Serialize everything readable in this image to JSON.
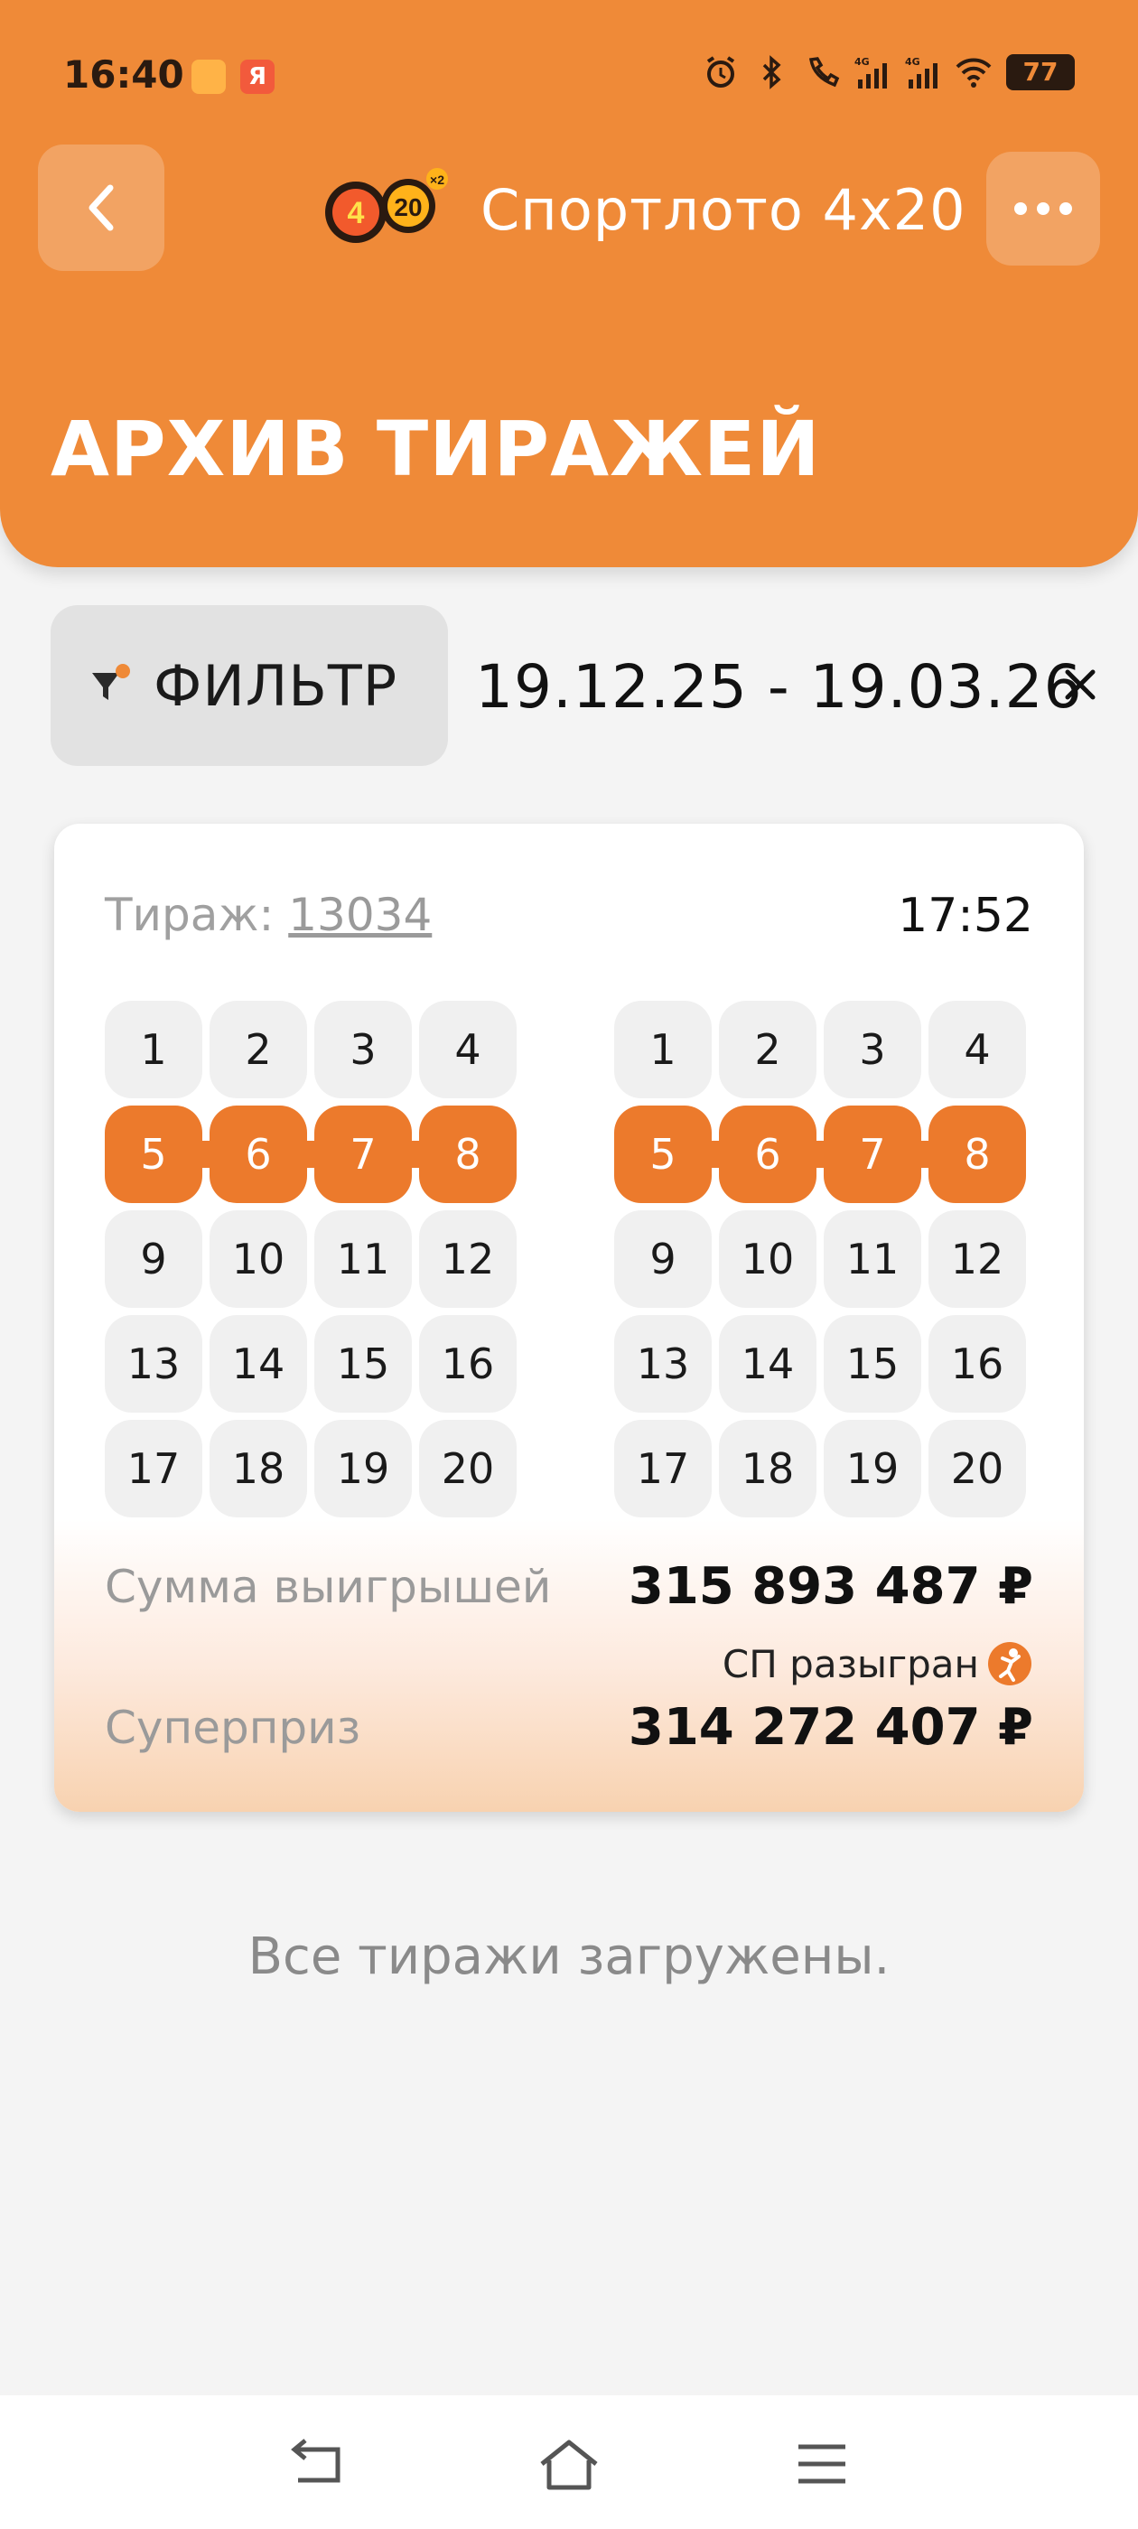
{
  "status_bar": {
    "time": "16:40",
    "app_badge": "Я",
    "battery": "77"
  },
  "header": {
    "app_title": "Спортлото 4х20",
    "page_title": "АРХИВ ТИРАЖЕЙ",
    "logo": {
      "left": "4",
      "right": "20",
      "badge": "×2"
    }
  },
  "filter": {
    "label": "ФИЛЬТР",
    "date_range": "19.12.25 - 19.03.26",
    "clear_symbol": "×"
  },
  "draw_card": {
    "draw_label": "Тираж:",
    "draw_number": "13034",
    "time": "17:52",
    "field1": {
      "numbers": [
        "1",
        "2",
        "3",
        "4",
        "5",
        "6",
        "7",
        "8",
        "9",
        "10",
        "11",
        "12",
        "13",
        "14",
        "15",
        "16",
        "17",
        "18",
        "19",
        "20"
      ],
      "winning": [
        "5",
        "6",
        "7",
        "8"
      ]
    },
    "field2": {
      "numbers": [
        "1",
        "2",
        "3",
        "4",
        "5",
        "6",
        "7",
        "8",
        "9",
        "10",
        "11",
        "12",
        "13",
        "14",
        "15",
        "16",
        "17",
        "18",
        "19",
        "20"
      ],
      "winning": [
        "5",
        "6",
        "7",
        "8"
      ]
    },
    "winnings_label": "Сумма выигрышей",
    "winnings_value": "315 893 487 ₽",
    "jackpot_status": "СП разыгран",
    "superprize_label": "Суперприз",
    "superprize_value": "314 272 407 ₽"
  },
  "footer_text": "Все тиражи загружены.",
  "colors": {
    "accent": "#ef8a38",
    "win": "#ec7a2c",
    "background": "#f4f4f4"
  }
}
